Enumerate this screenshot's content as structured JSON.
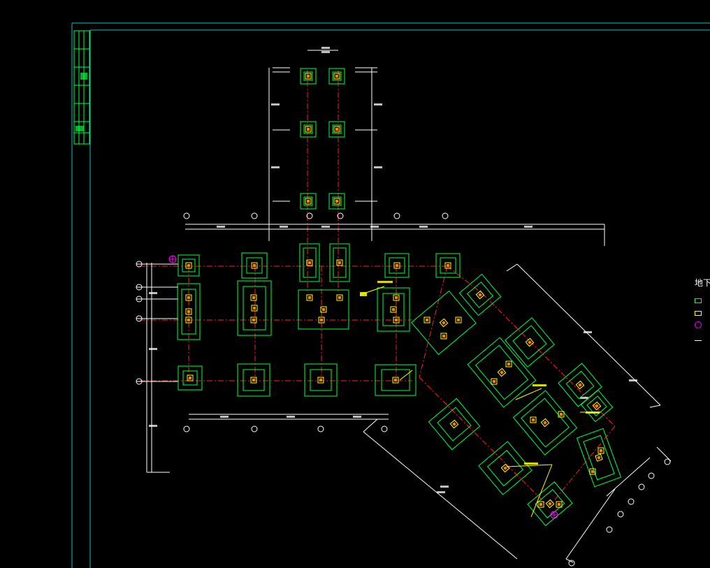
{
  "drawing": {
    "legend_title": "地下",
    "colors": {
      "background": "#000000",
      "frame": "#00c8c8",
      "title_block": "#00ff40",
      "footing": "#00ff40",
      "column": "#ffff00",
      "column_core": "#ff7f00",
      "axis": "#ff2020",
      "dimension": "#ffffff",
      "marker": "#ff00ff",
      "note": "#ffff00"
    }
  }
}
